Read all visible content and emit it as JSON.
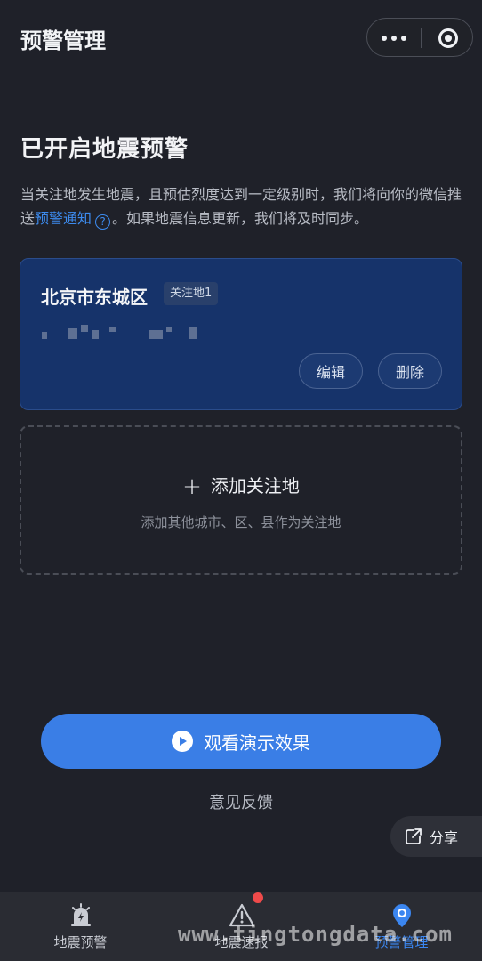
{
  "header": {
    "title": "预警管理"
  },
  "main": {
    "heading": "已开启地震预警",
    "desc_before": "当关注地发生地震，且预估烈度达到一定级别时，我们将向你的微信推送",
    "desc_link": "预警通知",
    "desc_after": "。如果地震信息更新，我们将及时同步。"
  },
  "location_card": {
    "name": "北京市东城区",
    "tag": "关注地1",
    "edit_label": "编辑",
    "delete_label": "删除"
  },
  "add_card": {
    "title": "添加关注地",
    "hint": "添加其他城市、区、县作为关注地"
  },
  "demo_button": {
    "label": "观看演示效果"
  },
  "feedback_link": {
    "label": "意见反馈"
  },
  "share_button": {
    "label": "分享"
  },
  "tabbar": {
    "items": [
      {
        "label": "地震预警",
        "icon": "siren-icon"
      },
      {
        "label": "地震速报",
        "icon": "warning-triangle-icon",
        "has_badge": true
      },
      {
        "label": "预警管理",
        "icon": "location-pin-icon",
        "active": true
      }
    ]
  },
  "watermark": "www.tingtongdata.com",
  "colors": {
    "background": "#1f2129",
    "accent": "#3a7ee6",
    "card": "#16336a",
    "badge": "#ef4a4a"
  }
}
